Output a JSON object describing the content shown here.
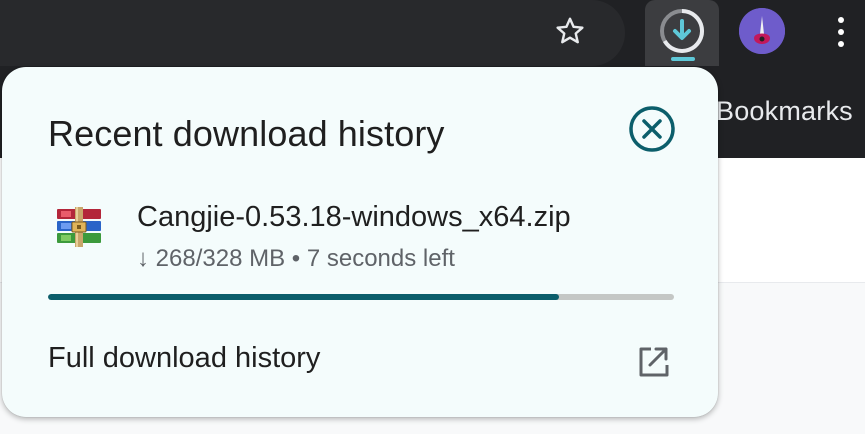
{
  "toolbar": {
    "star_icon": "star-outline-icon",
    "download_icon": "download-progress-icon",
    "avatar_icon": "guitar-avatar",
    "menu_icon": "kebab-menu-icon"
  },
  "bookmarks_bar": {
    "label": "Bookmarks"
  },
  "bubble": {
    "title": "Recent download history",
    "close_icon": "close-circle-icon",
    "download": {
      "file_icon": "winrar-archive-icon",
      "file_name": "Cangjie-0.53.18-windows_x64.zip",
      "status": "↓ 268/328 MB • 7 seconds left",
      "progress_fraction": 0.817
    },
    "full_history": {
      "label": "Full download history",
      "icon": "open-in-new-icon"
    }
  },
  "colors": {
    "chrome_dark": "#202124",
    "bubble_bg": "#f4fcfc",
    "accent_teal": "#0b5e6b",
    "text_primary": "#1f1f1f",
    "text_secondary": "#5f6368"
  }
}
